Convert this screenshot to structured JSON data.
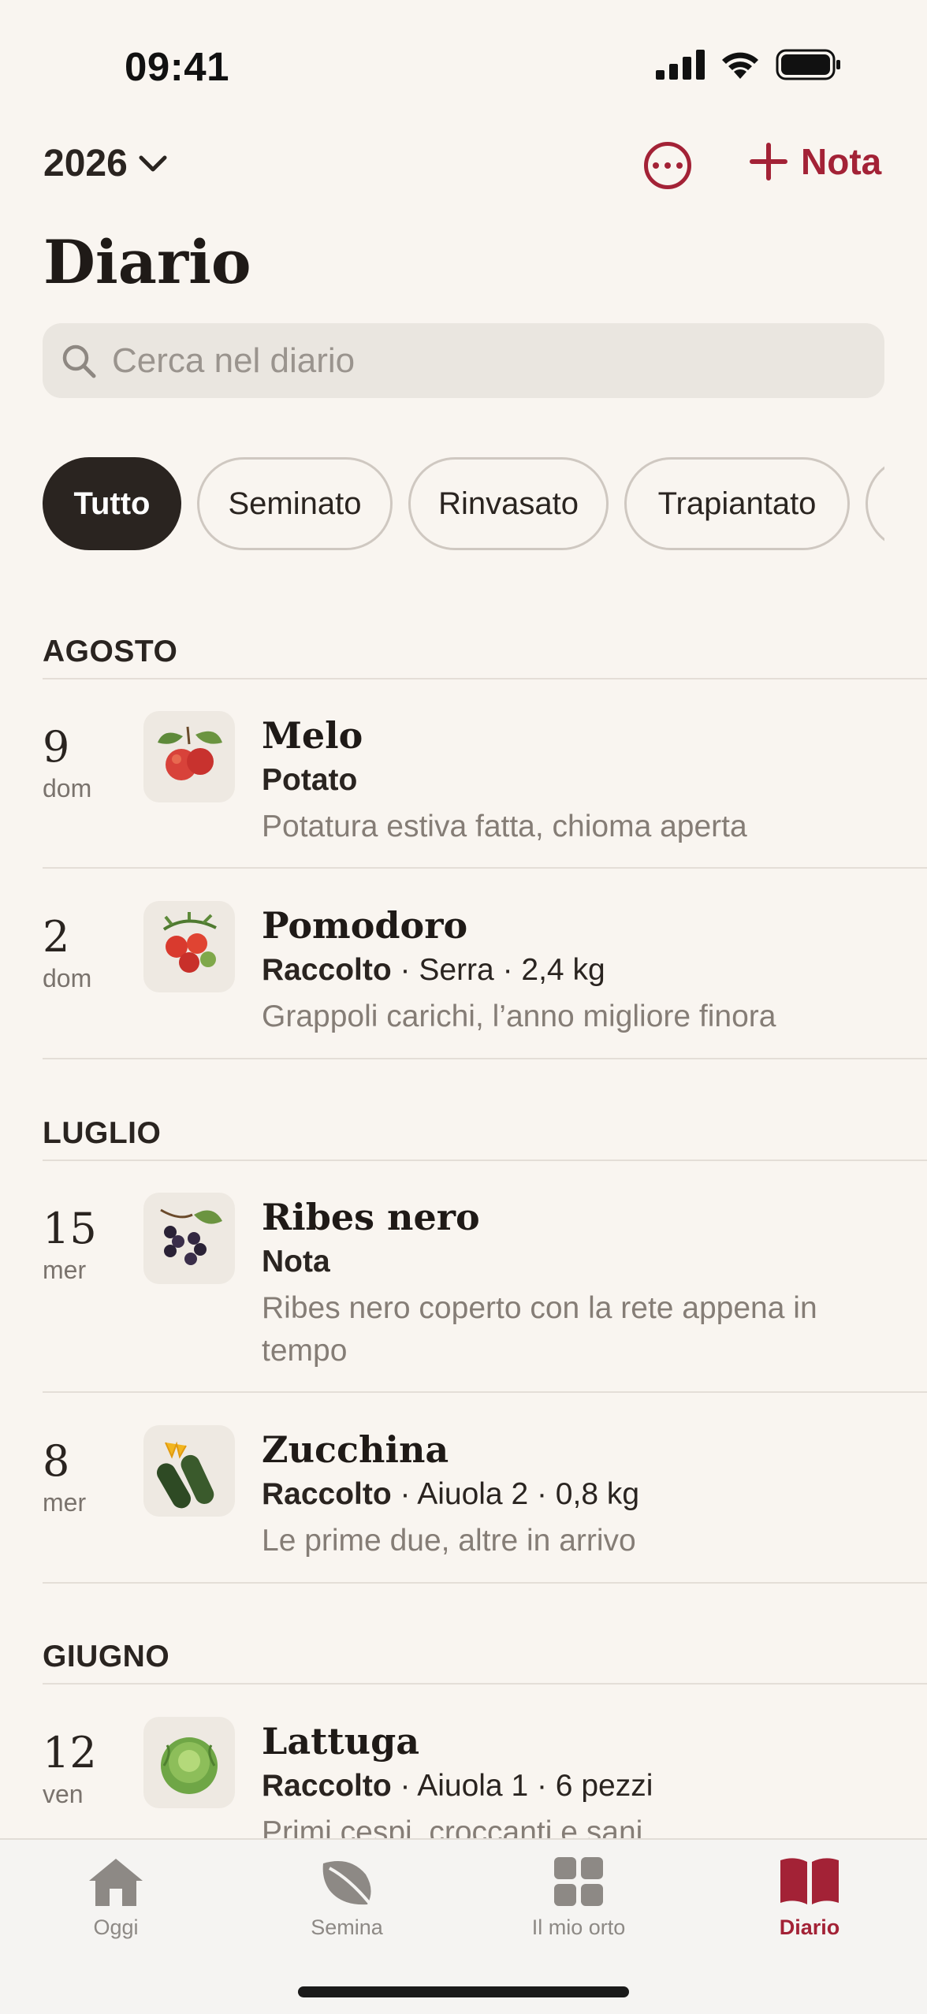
{
  "status_bar": {
    "time": "09:41"
  },
  "header": {
    "year": "2026",
    "add_note_label": "Nota",
    "title": "Diario"
  },
  "search": {
    "placeholder": "Cerca nel diario"
  },
  "filters": [
    "Tutto",
    "Seminato",
    "Rinvasato",
    "Trapiantato"
  ],
  "active_filter": "Tutto",
  "months": [
    {
      "name": "AGOSTO",
      "entries": [
        {
          "day": "9",
          "weekday": "dom",
          "plant": "Melo",
          "action": "Potato",
          "extra": "",
          "note": "Potatura estiva fatta, chioma aperta",
          "icon": "apple-icon"
        },
        {
          "day": "2",
          "weekday": "dom",
          "plant": "Pomodoro",
          "action": "Raccolto",
          "extra": " · Serra · 2,4 kg",
          "note": "Grappoli carichi, l’anno migliore finora",
          "icon": "tomato-icon"
        }
      ]
    },
    {
      "name": "LUGLIO",
      "entries": [
        {
          "day": "15",
          "weekday": "mer",
          "plant": "Ribes nero",
          "action": "Nota",
          "extra": "",
          "note": "Ribes nero coperto con la rete appena in tempo",
          "icon": "blackcurrant-icon"
        },
        {
          "day": "8",
          "weekday": "mer",
          "plant": "Zucchina",
          "action": "Raccolto",
          "extra": " · Aiuola 2 · 0,8 kg",
          "note": "Le prime due, altre in arrivo",
          "icon": "zucchini-icon"
        }
      ]
    },
    {
      "name": "GIUGNO",
      "entries": [
        {
          "day": "12",
          "weekday": "ven",
          "plant": "Lattuga",
          "action": "Raccolto",
          "extra": " · Aiuola 1 · 6 pezzi",
          "note": "Primi cespi, croccanti e sani",
          "icon": "lettuce-icon"
        }
      ]
    }
  ],
  "tabs": [
    {
      "label": "Oggi",
      "icon": "home-icon"
    },
    {
      "label": "Semina",
      "icon": "leaf-icon"
    },
    {
      "label": "Il mio orto",
      "icon": "grid-icon"
    },
    {
      "label": "Diario",
      "icon": "book-icon"
    }
  ],
  "active_tab": "Diario",
  "colors": {
    "accent": "#A32236",
    "background": "#F9F5F0",
    "chip_active": "#2A2420"
  }
}
